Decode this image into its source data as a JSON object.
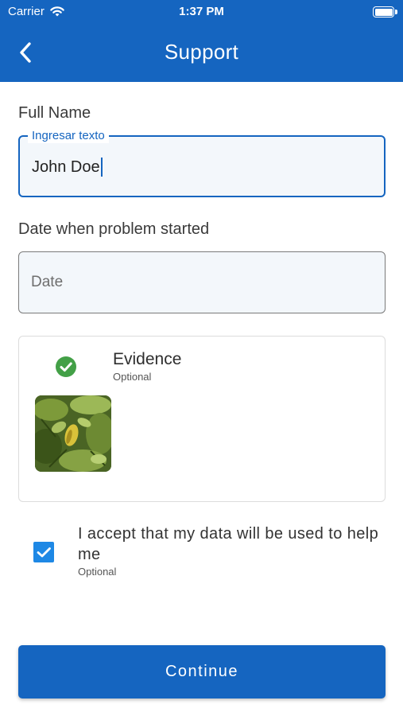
{
  "status_bar": {
    "carrier": "Carrier",
    "time": "1:37 PM"
  },
  "nav": {
    "title": "Support",
    "back_icon": "chevron-left-icon"
  },
  "form": {
    "full_name": {
      "label": "Full Name",
      "floating_label": "Ingresar texto",
      "value": "John Doe"
    },
    "date": {
      "label": "Date when problem started",
      "placeholder": "Date",
      "value": ""
    },
    "evidence": {
      "title": "Evidence",
      "subtitle": "Optional",
      "status_icon": "check-circle-icon",
      "status_color": "#43a047"
    },
    "consent": {
      "text": "I accept that my data will be used to help me",
      "subtitle": "Optional",
      "checked": true
    },
    "continue_label": "Continue"
  },
  "colors": {
    "primary": "#1565c0",
    "checkbox": "#1e88e5",
    "success": "#43a047"
  }
}
